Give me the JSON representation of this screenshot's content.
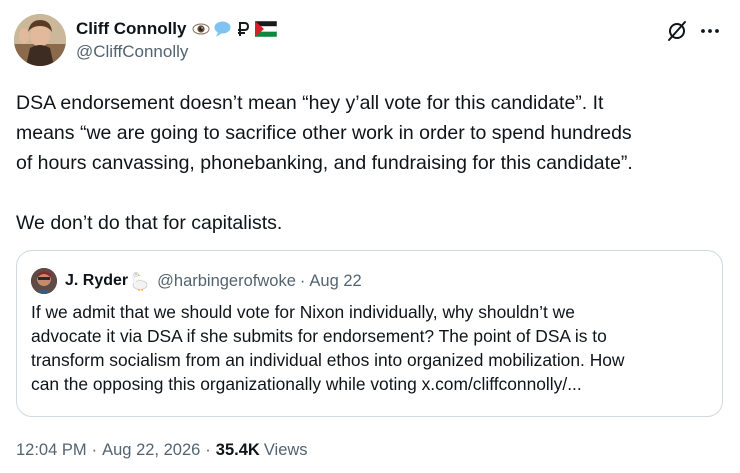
{
  "author": {
    "display_name": "Cliff Connolly",
    "handle": "@CliffConnolly",
    "name_emojis": [
      "eye-emoji",
      "speech-bubble-emoji",
      "ruble-sign-emoji",
      "palestine-flag-emoji"
    ]
  },
  "tweet": {
    "text": "DSA endorsement doesn’t mean “hey y’all vote for this candidate”. It\nmeans “we are going to sacrifice other work in order to spend hundreds\nof hours canvassing, phonebanking, and fundraising for this candidate”.\n\nWe don’t do that for capitalists."
  },
  "quoted": {
    "display_name": "J. Ryder",
    "name_emoji": "goose-emoji",
    "handle": "@harbingerofwoke",
    "separator": "·",
    "date": "Aug 22",
    "text": "If we admit that we should vote for Nixon individually, why shouldn’t we\nadvocate it via DSA if she submits for endorsement? The point of DSA is to\ntransform socialism from an individual ethos into organized mobilization. How\ncan the opposing this organizationally while voting x.com/cliffconnolly/..."
  },
  "meta": {
    "time": "12:04 PM",
    "date": "Aug 22, 2026",
    "separator": "·",
    "views_count": "35.4K",
    "views_label": "Views"
  },
  "icons": {
    "grok": "grok-icon",
    "more": "more-icon"
  },
  "colors": {
    "text_primary": "#0f1419",
    "text_secondary": "#536471",
    "border": "#cfd9de"
  }
}
